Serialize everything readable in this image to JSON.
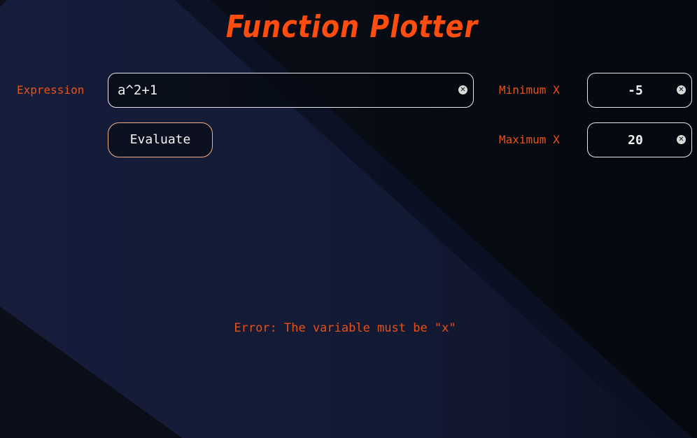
{
  "app": {
    "title": "Function Plotter"
  },
  "expression": {
    "label": "Expression",
    "value": "a^2+1",
    "clear_icon": "clear-icon"
  },
  "min_x": {
    "label": "Minimum X",
    "value": "-5",
    "clear_icon": "clear-icon"
  },
  "max_x": {
    "label": "Maximum X",
    "value": "20",
    "clear_icon": "clear-icon"
  },
  "evaluate_button": {
    "label": "Evaluate"
  },
  "error": {
    "message": "Error: The variable must be \"x\""
  },
  "colors": {
    "accent": "#ff4c0f",
    "background": "#070b12",
    "stripe": "#151d3a",
    "field_border": "#e9e6f0"
  }
}
